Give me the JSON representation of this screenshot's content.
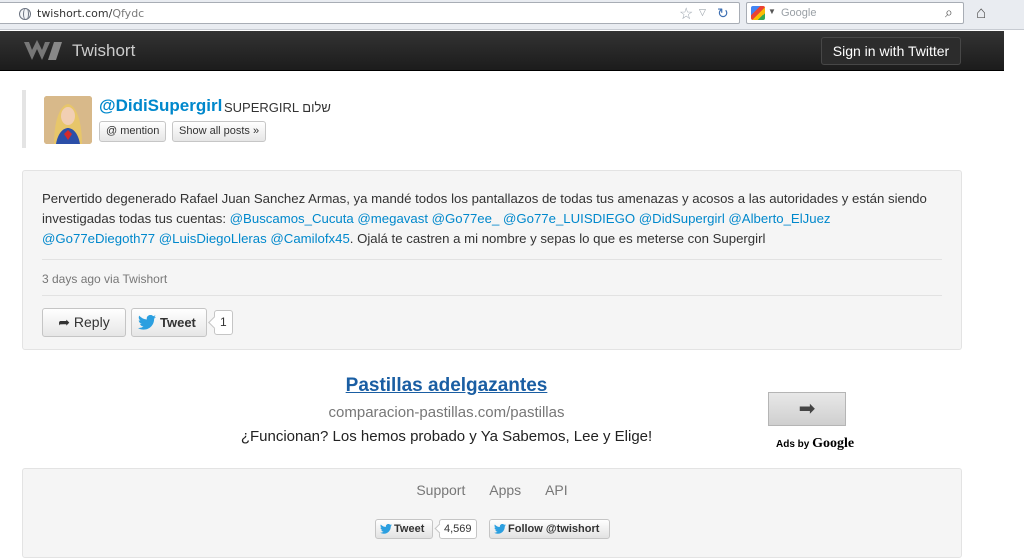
{
  "browser": {
    "url_host": "twishort.com/",
    "url_path": "Qfydc",
    "search_placeholder": "Google"
  },
  "topbar": {
    "brand": "Twishort",
    "signin_label": "Sign in with Twitter"
  },
  "profile": {
    "username": "@DidiSupergirl",
    "realname": "SUPERGIRL שלום",
    "mention_label": "@ mention",
    "show_posts_label": "Show all posts »"
  },
  "tweet": {
    "text_start": "Pervertido degenerado Rafael Juan Sanchez Armas, ya mandé todos los pantallazos de todas tus amenazas y acosos a las autoridades y están siendo investigadas todas tus cuentas: ",
    "mentions": [
      "@Buscamos_Cucuta",
      "@megavast",
      "@Go77ee_",
      "@Go77e_LUISDIEGO",
      "@DidSupergirl",
      "@Alberto_ElJuez",
      "@Go77eDiegoth77",
      "@LuisDiegoLleras",
      "@Camilofx45"
    ],
    "text_end": ". Ojalá te castren a mi nombre y sepas lo que es meterse con Supergirl",
    "meta": "3 days ago via Twishort",
    "reply_label": "Reply",
    "tweet_label": "Tweet",
    "tweet_count": "1"
  },
  "ad": {
    "title": "Pastillas adelgazantes",
    "url": "comparacion-pastillas.com/pastillas",
    "description": "¿Funcionan? Los hemos probado y Ya Sabemos, Lee y Elige!",
    "ads_by": "Ads by",
    "google": "Google"
  },
  "footer": {
    "links": [
      "Support",
      "Apps",
      "API"
    ],
    "tweet_label": "Tweet",
    "tweet_count": "4,569",
    "follow_label": "Follow @twishort"
  },
  "colors": {
    "link": "#0088cc",
    "topbar": "#222222",
    "ad_title": "#1a5ea3"
  }
}
